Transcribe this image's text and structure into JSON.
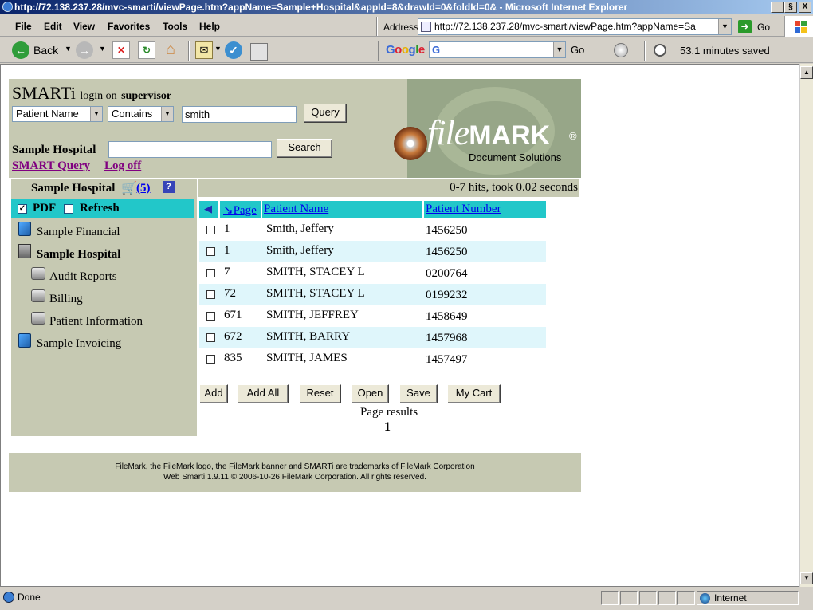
{
  "window": {
    "title": "http://72.138.237.28/mvc-smarti/viewPage.htm?appName=Sample+Hospital&appId=8&drawId=0&foldId=0& - Microsoft Internet Explorer",
    "controls": [
      "_",
      "§",
      "X"
    ]
  },
  "menubar": {
    "items": [
      "File",
      "Edit",
      "View",
      "Favorites",
      "Tools",
      "Help"
    ],
    "address_label": "Address",
    "address_value": "http://72.138.237.28/mvc-smarti/viewPage.htm?appName=Sa",
    "go_label": "Go"
  },
  "toolbar": {
    "back_label": "Back",
    "google_search_value": "G",
    "google_go": "Go",
    "saved_text": "53.1 minutes saved"
  },
  "app": {
    "brand": "SMARTi",
    "login_text": "login on",
    "user": "supervisor",
    "field_select": "Patient Name",
    "operator_select": "Contains",
    "query_value": "smith",
    "query_button": "Query",
    "hospital_label": "Sample Hospital",
    "search_value": "",
    "search_button": "Search",
    "link_smart_query": "SMART Query",
    "link_logoff": "Log off",
    "logo_main": "file",
    "logo_bold": "MARK",
    "logo_reg": "®",
    "logo_sub": "Document Solutions"
  },
  "sidebar": {
    "title": "Sample Hospital",
    "cart_count": "(5)",
    "help": "?",
    "pdf_label": "PDF",
    "refresh_label": "Refresh",
    "items": [
      {
        "label": "Sample Financial"
      },
      {
        "label": "Sample Hospital"
      },
      {
        "label": "Audit Reports"
      },
      {
        "label": "Billing"
      },
      {
        "label": "Patient Information"
      },
      {
        "label": "Sample Invoicing"
      }
    ]
  },
  "results": {
    "hits": "0-7 hits, took 0.02 seconds",
    "columns": [
      "Page",
      "Patient Name",
      "Patient Number"
    ],
    "rows": [
      {
        "page": "1",
        "name": "Smith, Jeffery",
        "number": "1456250"
      },
      {
        "page": "1",
        "name": "Smith, Jeffery",
        "number": "1456250"
      },
      {
        "page": "7",
        "name": "SMITH, STACEY L",
        "number": "0200764"
      },
      {
        "page": "72",
        "name": "SMITH, STACEY L",
        "number": "0199232"
      },
      {
        "page": "671",
        "name": "SMITH, JEFFREY",
        "number": "1458649"
      },
      {
        "page": "672",
        "name": "SMITH, BARRY",
        "number": "1457968"
      },
      {
        "page": "835",
        "name": "SMITH, JAMES",
        "number": "1457497"
      }
    ],
    "buttons": [
      "Add",
      "Add All",
      "Reset",
      "Open",
      "Save",
      "My Cart"
    ],
    "page_results_label": "Page results",
    "page_number": "1"
  },
  "footer": {
    "line1": "FileMark, the FileMark logo, the FileMark banner and SMARTi are trademarks of FileMark Corporation",
    "line2": "Web Smarti 1.9.11 © 2006-10-26 FileMark Corporation. All rights reserved."
  },
  "statusbar": {
    "status": "Done",
    "zone": "Internet"
  }
}
